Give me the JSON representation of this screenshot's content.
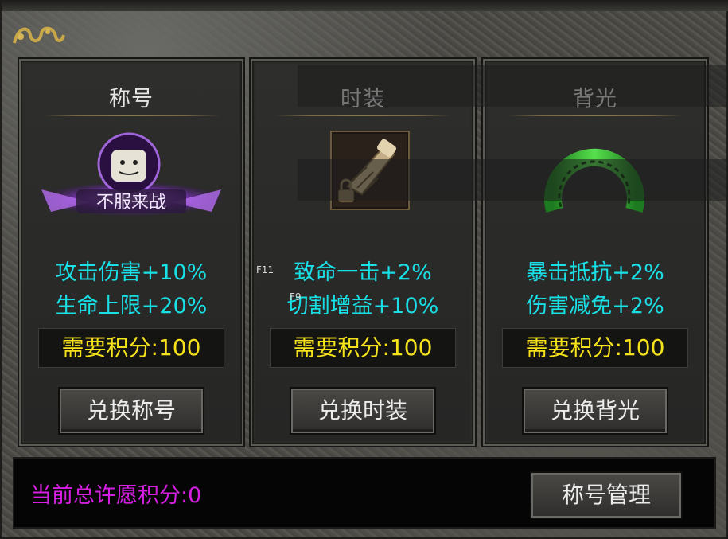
{
  "panels": [
    {
      "title": "称号",
      "stats": [
        "攻击伤害+10%",
        "生命上限+20%"
      ],
      "cost": "需要积分:100",
      "button": "兑换称号",
      "icon": "title-badge-icon",
      "badge_text": "不服来战"
    },
    {
      "title": "时装",
      "stats": [
        "致命一击+2%",
        "切割增益+10%"
      ],
      "cost": "需要积分:100",
      "button": "兑换时装",
      "icon": "gauntlet-fashion-icon"
    },
    {
      "title": "背光",
      "stats": [
        "暴击抵抗+2%",
        "伤害减免+2%"
      ],
      "cost": "需要积分:100",
      "button": "兑换背光",
      "icon": "green-halo-icon"
    }
  ],
  "footer": {
    "points_label": "当前总许愿积分:0",
    "manage_button": "称号管理"
  },
  "hotkeys": [
    "F11",
    "F9"
  ],
  "colors": {
    "stat_text": "#19dfe6",
    "cost_text": "#f5e21a",
    "points_text": "#d51fe0"
  }
}
